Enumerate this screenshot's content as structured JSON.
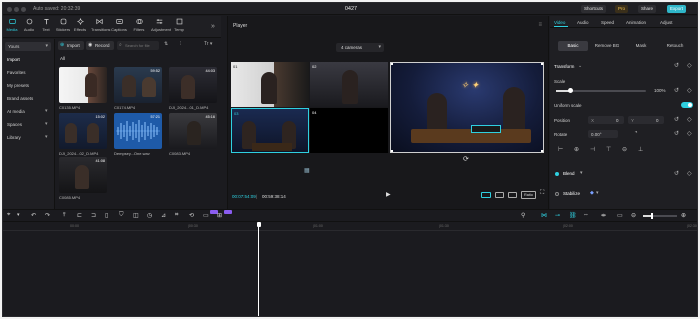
{
  "titlebar": {
    "autosave": "Auto saved: 20:32:39",
    "project_name": "0427",
    "shortcuts": "Shortcuts",
    "pro": "Pro",
    "share": "Share",
    "export": "Export"
  },
  "tools": [
    {
      "label": "Media",
      "icon": "media-icon"
    },
    {
      "label": "Audio",
      "icon": "audio-icon"
    },
    {
      "label": "Text",
      "icon": "text-icon"
    },
    {
      "label": "Stickers",
      "icon": "stickers-icon"
    },
    {
      "label": "Effects",
      "icon": "effects-icon"
    },
    {
      "label": "Transitions",
      "icon": "transitions-icon"
    },
    {
      "label": "Captions",
      "icon": "captions-icon"
    },
    {
      "label": "Filters",
      "icon": "filters-icon"
    },
    {
      "label": "Adjustment",
      "icon": "adjustment-icon"
    },
    {
      "label": "Temp",
      "icon": "template-icon"
    }
  ],
  "sidebar": {
    "selected": "Yours",
    "items": [
      "Import",
      "Favorites",
      "My presets",
      "Brand assets",
      "AI media",
      "Spaces",
      "Library"
    ]
  },
  "media": {
    "import_label": "Import",
    "record_label": "Record",
    "search_placeholder": "Search for file",
    "all_label": "All",
    "clips": [
      {
        "name": "C0135.MP4",
        "duration": ""
      },
      {
        "name": "C0174.MP4",
        "duration": "59:52"
      },
      {
        "name": "DJI_2024...01_D.MP4",
        "duration": "44:03"
      },
      {
        "name": "DJI_2024...02_D.MP4",
        "duration": "15:02"
      },
      {
        "name": "Dempsey...One.wav",
        "duration": "57:21"
      },
      {
        "name": "C0083.MP4",
        "duration": "45:16"
      },
      {
        "name": "C0085.MP4",
        "duration": "41:08"
      }
    ]
  },
  "player": {
    "title": "Player",
    "camera_select": "4 cameras",
    "camera_numbers": [
      "01",
      "02",
      "03",
      "04"
    ],
    "timecode_current": "00:07:54:09",
    "timecode_total": "00:59:38:14",
    "ratio_label": "Ratio"
  },
  "right_panel": {
    "tabs": [
      "Video",
      "Audio",
      "Speed",
      "Animation",
      "Adjust"
    ],
    "sub_tabs": [
      "Basic",
      "Remove BG",
      "Mask",
      "Retouch"
    ],
    "transform_label": "Transform",
    "scale_label": "Scale",
    "scale_value": "100%",
    "uniform_scale_label": "Uniform scale",
    "position_label": "Position",
    "pos_x_label": "X",
    "pos_x_value": "0",
    "pos_y_label": "Y",
    "pos_y_value": "0",
    "rotate_label": "Rotate",
    "rotate_value": "0.00°",
    "blend_label": "Blend",
    "stabilize_label": "Stabilize",
    "accent": "#2fd0e0"
  },
  "timeline": {
    "ruler": [
      "00:00",
      "|00:30",
      "|01:00",
      "|01:30",
      "|02:00",
      "|02:30",
      "|03:00",
      "|03:30"
    ]
  }
}
